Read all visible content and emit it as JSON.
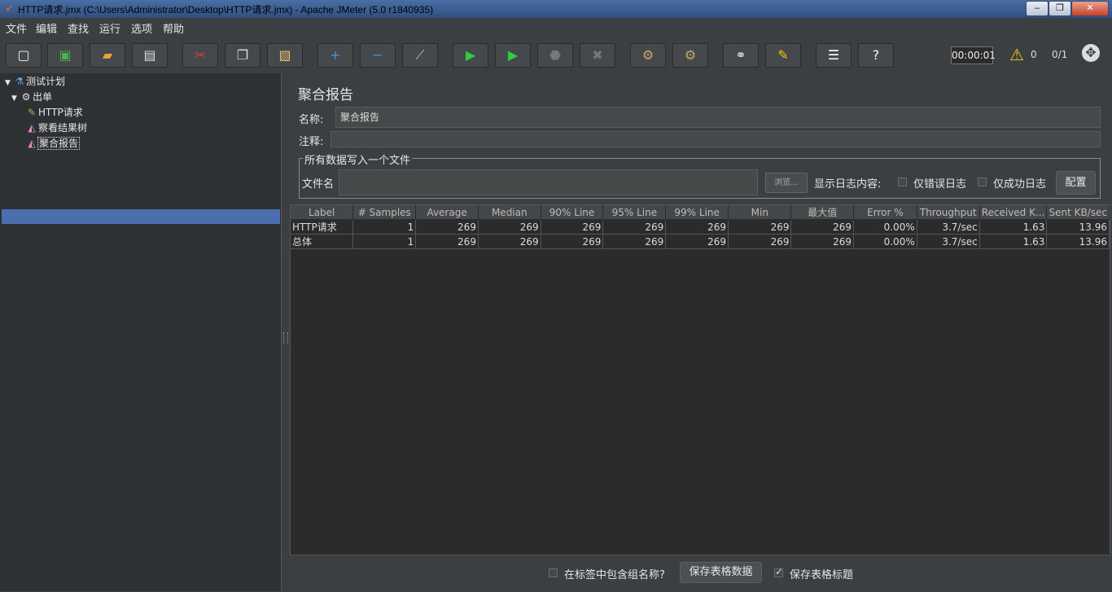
{
  "window": {
    "title": "HTTP请求.jmx (C:\\Users\\Administrator\\Desktop\\HTTP请求.jmx) - Apache JMeter (5.0 r1840935)",
    "minimize": "‒",
    "maximize": "❐",
    "close": "✕"
  },
  "menu": [
    "文件",
    "编辑",
    "查找",
    "运行",
    "选项",
    "帮助"
  ],
  "toolbar": {
    "buttons": [
      {
        "name": "new-icon",
        "glyph": "▢",
        "color": "#f0f0f0"
      },
      {
        "name": "templates-icon",
        "glyph": "▣",
        "color": "#4caf50"
      },
      {
        "name": "open-icon",
        "glyph": "▰",
        "color": "#e8a33a"
      },
      {
        "name": "save-icon",
        "glyph": "▤",
        "color": "#dddddd"
      },
      {
        "name": "cut-icon",
        "glyph": "✂",
        "color": "#e53935"
      },
      {
        "name": "copy-icon",
        "glyph": "❐",
        "color": "#dddddd"
      },
      {
        "name": "paste-icon",
        "glyph": "▧",
        "color": "#e8c26a"
      },
      {
        "name": "expand-icon",
        "glyph": "+",
        "color": "#4a90e2"
      },
      {
        "name": "collapse-icon",
        "glyph": "−",
        "color": "#4a90e2"
      },
      {
        "name": "toggle-icon",
        "glyph": "⟋",
        "color": "#9ec3e6"
      },
      {
        "name": "start-icon",
        "glyph": "▶",
        "color": "#2ecc40"
      },
      {
        "name": "start-no-pause-icon",
        "glyph": "▶",
        "color": "#2ecc40"
      },
      {
        "name": "stop-icon",
        "glyph": "⬣",
        "color": "#777777"
      },
      {
        "name": "shutdown-icon",
        "glyph": "✖",
        "color": "#777777"
      },
      {
        "name": "clear-icon",
        "glyph": "⚙",
        "color": "#c9a46a"
      },
      {
        "name": "clear-all-icon",
        "glyph": "⚙",
        "color": "#c9a46a"
      },
      {
        "name": "search-icon",
        "glyph": "⚭",
        "color": "#dddddd"
      },
      {
        "name": "reset-search-icon",
        "glyph": "✎",
        "color": "#f1c40f"
      },
      {
        "name": "function-helper-icon",
        "glyph": "☰",
        "color": "#ffffff"
      },
      {
        "name": "help-icon",
        "glyph": "?",
        "color": "#ffffff"
      }
    ],
    "timer": "00:00:01",
    "warning_count": "0",
    "threads": "0/1"
  },
  "tree": [
    {
      "label": "测试计划",
      "icon": "flask-icon",
      "glyph": "⚗",
      "indent": 0,
      "arrow": "▼"
    },
    {
      "label": "出单",
      "icon": "thread-group-icon",
      "glyph": "⚙",
      "indent": 1,
      "arrow": "▼"
    },
    {
      "label": "HTTP请求",
      "icon": "sampler-icon",
      "glyph": "✎",
      "indent": 2,
      "arrow": ""
    },
    {
      "label": "察看结果树",
      "icon": "listener-icon",
      "glyph": "◭",
      "indent": 2,
      "arrow": ""
    },
    {
      "label": "聚合报告",
      "icon": "listener-icon",
      "glyph": "◭",
      "indent": 2,
      "arrow": "",
      "selected": true
    }
  ],
  "panel": {
    "title": "聚合报告",
    "name_label": "名称:",
    "name_value": "聚合报告",
    "comment_label": "注释:",
    "comment_value": "",
    "group_title": "所有数据写入一个文件",
    "filename_label": "文件名",
    "filename_value": "",
    "browse": "浏览...",
    "log_label": "显示日志内容:",
    "errors_only": "仅错误日志",
    "success_only": "仅成功日志",
    "configure": "配置"
  },
  "table": {
    "headers": [
      "Label",
      "# Samples",
      "Average",
      "Median",
      "90% Line",
      "95% Line",
      "99% Line",
      "Min",
      "最大值",
      "Error %",
      "Throughput",
      "Received K...",
      "Sent KB/sec"
    ],
    "rows": [
      [
        "HTTP请求",
        "1",
        "269",
        "269",
        "269",
        "269",
        "269",
        "269",
        "269",
        "0.00%",
        "3.7/sec",
        "1.63",
        "13.96"
      ],
      [
        "总体",
        "1",
        "269",
        "269",
        "269",
        "269",
        "269",
        "269",
        "269",
        "0.00%",
        "3.7/sec",
        "1.63",
        "13.96"
      ]
    ]
  },
  "bottom": {
    "include_group_name": "在标签中包含组名称?",
    "save_table_data": "保存表格数据",
    "save_table_header": "保存表格标题"
  }
}
